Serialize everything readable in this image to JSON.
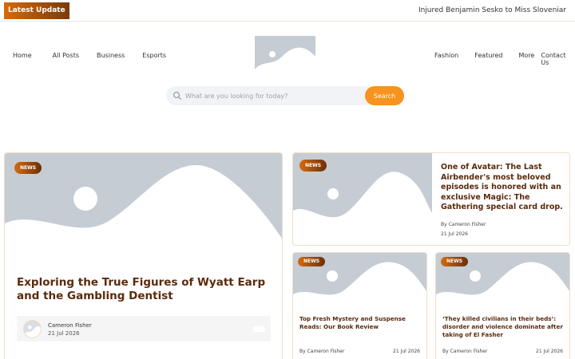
{
  "ticker": {
    "label": "Latest Update",
    "headline": "Injured Benjamin Sesko to Miss Sloveniar"
  },
  "nav": {
    "left": [
      "Home",
      "All Posts",
      "Business",
      "Esports"
    ],
    "right": [
      "Fashion",
      "Featured",
      "More",
      "Contact Us"
    ]
  },
  "search": {
    "placeholder": "What are you looking for today?",
    "button": "Search"
  },
  "featured": {
    "badge": "NEWS",
    "title": "Exploring the True Figures of Wyatt Earp and the Gambling Dentist",
    "author": "Cameron Fisher",
    "date": "21 Jul 2026"
  },
  "side": {
    "badge": "NEWS",
    "title": "One of Avatar: The Last Airbender's most beloved episodes is honored with an exclusive Magic: The Gathering special card drop.",
    "author": "By Cameron Fisher",
    "date": "21 Jul 2026"
  },
  "small": [
    {
      "badge": "NEWS",
      "title": "Top Fresh Mystery and Suspense Reads: Our Book Review",
      "author": "By Cameron Fisher",
      "date": "21 Jul 2026"
    },
    {
      "badge": "NEWS",
      "title": "‘They killed civilians in their beds’: disorder and violence dominate after taking of El Fasher",
      "author": "By Cameron Fisher",
      "date": "21 Jul 2026"
    }
  ],
  "colors": {
    "accent": "#f7931e",
    "badge_dark": "#6d2f08",
    "title": "#5a2a0c",
    "placeholder_bg": "#c5ccd4"
  },
  "icons": {
    "search": "search-icon",
    "image": "image-placeholder-icon"
  }
}
